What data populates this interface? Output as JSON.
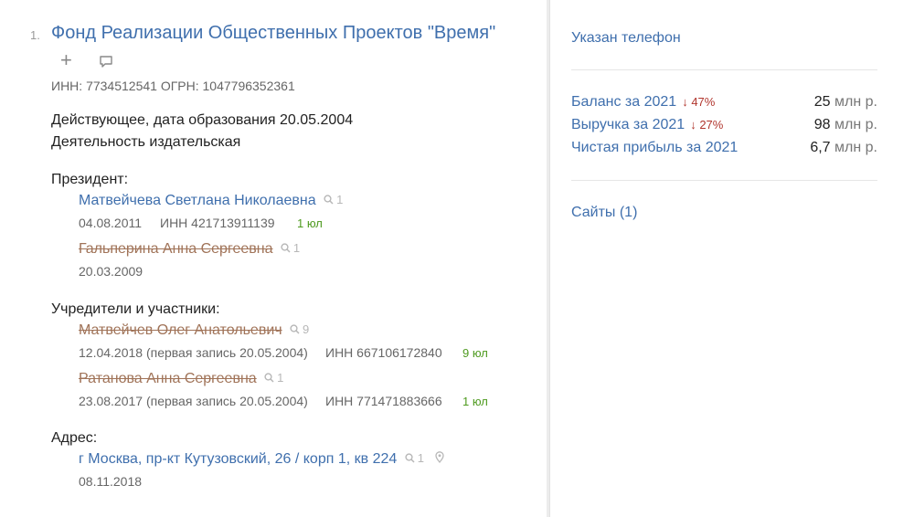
{
  "company": {
    "index": "1.",
    "name": "Фонд Реализации Общественных Проектов \"Время\"",
    "ids": "ИНН: 7734512541   ОГРН: 1047796352361",
    "status": "Действующее, дата образования 20.05.2004",
    "activity": "Деятельность издательская"
  },
  "president": {
    "heading": "Президент:",
    "current": {
      "name": "Матвейчева Светлана Николаевна",
      "search_count": "1",
      "date": "04.08.2011",
      "inn": "ИНН 421713911139",
      "legal_count": "1 юл"
    },
    "former": {
      "name": "Гальперина Анна Сергеевна",
      "search_count": "1",
      "date": "20.03.2009"
    }
  },
  "founders": {
    "heading": "Учредители и участники:",
    "items": [
      {
        "name": "Матвейчев Олег Анатольевич",
        "search_count": "9",
        "date": "12.04.2018 (первая запись 20.05.2004)",
        "inn": "ИНН 667106172840",
        "legal_count": "9 юл"
      },
      {
        "name": "Ратанова Анна Сергеевна",
        "search_count": "1",
        "date": "23.08.2017 (первая запись 20.05.2004)",
        "inn": "ИНН 771471883666",
        "legal_count": "1 юл"
      }
    ]
  },
  "address": {
    "heading": "Адрес:",
    "value": "г Москва, пр-кт Кутузовский, 26 / корп 1, кв 224",
    "search_count": "1",
    "date": "08.11.2018"
  },
  "sidebar": {
    "phone": "Указан телефон",
    "finance": [
      {
        "label": "Баланс за 2021",
        "trend": "47%",
        "value": "25",
        "unit": "млн р."
      },
      {
        "label": "Выручка за 2021",
        "trend": "27%",
        "value": "98",
        "unit": "млн р."
      },
      {
        "label": "Чистая прибыль за 2021",
        "trend": "",
        "value": "6,7",
        "unit": "млн р."
      }
    ],
    "sites": "Сайты (1)"
  },
  "colors": {
    "link": "#3f6fad",
    "status_green": "#4e9a1f",
    "strike_brown": "#a07358",
    "trend_red": "#b1362e"
  },
  "icons": [
    "plus-icon",
    "comment-icon",
    "search-icon",
    "map-pin-icon",
    "arrow-down-icon"
  ]
}
